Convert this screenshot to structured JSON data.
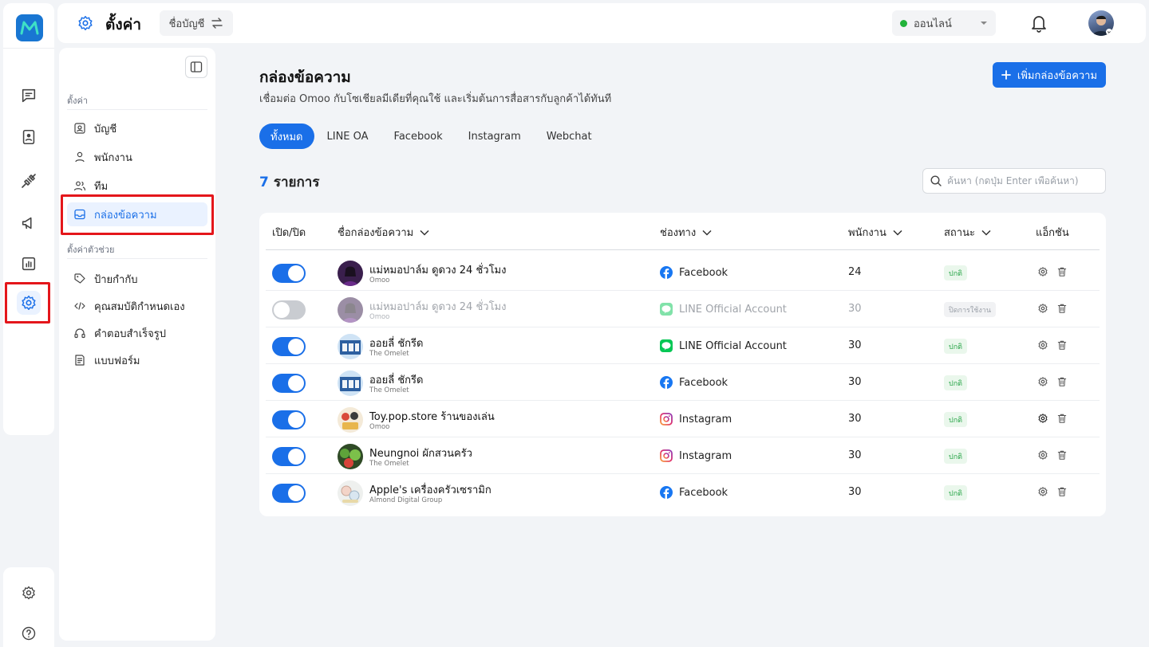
{
  "topbar": {
    "title": "ตั้งค่า",
    "account_switch_label": "ชื่อบัญชี",
    "status_label": "ออนไลน์"
  },
  "settings_panel": {
    "section1_heading": "ตั้งค่า",
    "section1_items": [
      "บัญชี",
      "พนักงาน",
      "ทีม",
      "กล่องข้อความ"
    ],
    "section2_heading": "ตั้งค่าตัวช่วย",
    "section2_items": [
      "ป้ายกำกับ",
      "คุณสมบัติกำหนดเอง",
      "คำตอบสำเร็จรูป",
      "แบบฟอร์ม"
    ],
    "active_item": "กล่องข้อความ"
  },
  "main": {
    "title": "กล่องข้อความ",
    "subtitle": "เชื่อมต่อ Omoo กับโซเชียลมีเดียที่คุณใช้ และเริ่มต้นการสื่อสารกับลูกค้าได้ทันที",
    "add_button": "เพิ่มกล่องข้อความ",
    "tabs": [
      "ทั้งหมด",
      "LINE OA",
      "Facebook",
      "Instagram",
      "Webchat"
    ],
    "active_tab": "ทั้งหมด",
    "count_number": "7",
    "count_label": "รายการ",
    "search_placeholder": "ค้นหา (กดปุ่ม Enter เพื่อค้นหา)"
  },
  "table": {
    "headers": {
      "toggle": "เปิด/ปิด",
      "name": "ชื่อกล่องข้อความ",
      "channel": "ช่องทาง",
      "staff": "พนักงาน",
      "status": "สถานะ",
      "actions": "แอ็กชัน"
    },
    "rows": [
      {
        "enabled": true,
        "name": "แม่หมอปาล์ม ดูดวง 24 ชั่วโมง",
        "workspace": "Omoo",
        "channel": "Facebook",
        "channel_icon": "facebook-icon",
        "staff": "24",
        "status": "ปกติ"
      },
      {
        "enabled": false,
        "name": "แม่หมอปาล์ม ดูดวง 24 ชั่วโมง",
        "workspace": "Omoo",
        "channel": "LINE Official Account",
        "channel_icon": "line-icon",
        "staff": "30",
        "status": "ปิดการใช้งาน"
      },
      {
        "enabled": true,
        "name": "ออยลี่ ชักรีด",
        "workspace": "The Omelet",
        "channel": "LINE Official Account",
        "channel_icon": "line-icon",
        "staff": "30",
        "status": "ปกติ"
      },
      {
        "enabled": true,
        "name": "ออยลี่ ชักรีด",
        "workspace": "The Omelet",
        "channel": "Facebook",
        "channel_icon": "facebook-icon",
        "staff": "30",
        "status": "ปกติ"
      },
      {
        "enabled": true,
        "name": "Toy.pop.store ร้านของเล่น",
        "workspace": "Omoo",
        "channel": "Instagram",
        "channel_icon": "instagram-icon",
        "staff": "30",
        "status": "ปกติ"
      },
      {
        "enabled": true,
        "name": "Neungnoi ผักสวนครัว",
        "workspace": "The Omelet",
        "channel": "Instagram",
        "channel_icon": "instagram-icon",
        "staff": "30",
        "status": "ปกติ"
      },
      {
        "enabled": true,
        "name": "Apple's เครื่องครัวเซรามิก",
        "workspace": "Almond Digital Group",
        "channel": "Facebook",
        "channel_icon": "facebook-icon",
        "staff": "30",
        "status": "ปกติ"
      }
    ]
  },
  "colors": {
    "primary": "#1a6fe8",
    "highlight_box": "#e4161b",
    "online_dot": "#22b33a",
    "status_ok_text": "#2aa64a"
  }
}
